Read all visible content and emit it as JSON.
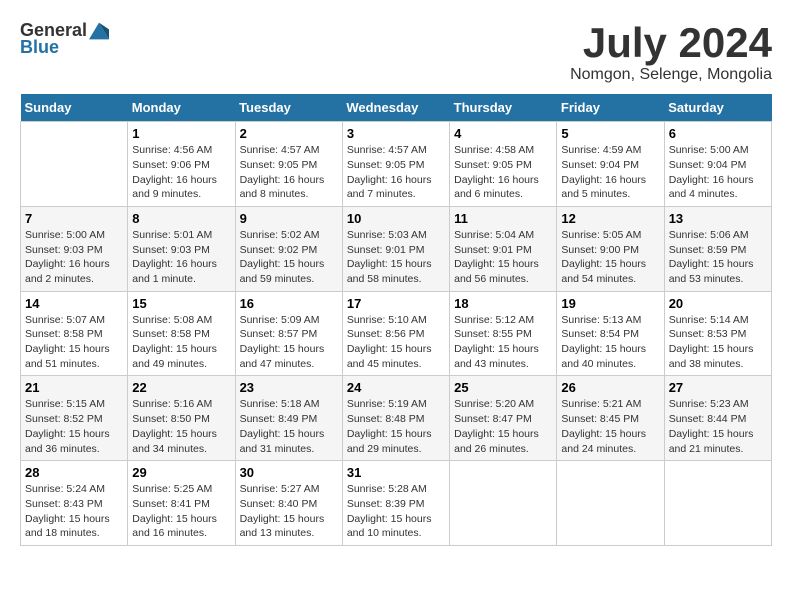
{
  "header": {
    "logo_general": "General",
    "logo_blue": "Blue",
    "title": "July 2024",
    "subtitle": "Nomgon, Selenge, Mongolia"
  },
  "days_of_week": [
    "Sunday",
    "Monday",
    "Tuesday",
    "Wednesday",
    "Thursday",
    "Friday",
    "Saturday"
  ],
  "weeks": [
    [
      {
        "day": "",
        "sunrise": "",
        "sunset": "",
        "daylight": ""
      },
      {
        "day": "1",
        "sunrise": "Sunrise: 4:56 AM",
        "sunset": "Sunset: 9:06 PM",
        "daylight": "Daylight: 16 hours and 9 minutes."
      },
      {
        "day": "2",
        "sunrise": "Sunrise: 4:57 AM",
        "sunset": "Sunset: 9:05 PM",
        "daylight": "Daylight: 16 hours and 8 minutes."
      },
      {
        "day": "3",
        "sunrise": "Sunrise: 4:57 AM",
        "sunset": "Sunset: 9:05 PM",
        "daylight": "Daylight: 16 hours and 7 minutes."
      },
      {
        "day": "4",
        "sunrise": "Sunrise: 4:58 AM",
        "sunset": "Sunset: 9:05 PM",
        "daylight": "Daylight: 16 hours and 6 minutes."
      },
      {
        "day": "5",
        "sunrise": "Sunrise: 4:59 AM",
        "sunset": "Sunset: 9:04 PM",
        "daylight": "Daylight: 16 hours and 5 minutes."
      },
      {
        "day": "6",
        "sunrise": "Sunrise: 5:00 AM",
        "sunset": "Sunset: 9:04 PM",
        "daylight": "Daylight: 16 hours and 4 minutes."
      }
    ],
    [
      {
        "day": "7",
        "sunrise": "Sunrise: 5:00 AM",
        "sunset": "Sunset: 9:03 PM",
        "daylight": "Daylight: 16 hours and 2 minutes."
      },
      {
        "day": "8",
        "sunrise": "Sunrise: 5:01 AM",
        "sunset": "Sunset: 9:03 PM",
        "daylight": "Daylight: 16 hours and 1 minute."
      },
      {
        "day": "9",
        "sunrise": "Sunrise: 5:02 AM",
        "sunset": "Sunset: 9:02 PM",
        "daylight": "Daylight: 15 hours and 59 minutes."
      },
      {
        "day": "10",
        "sunrise": "Sunrise: 5:03 AM",
        "sunset": "Sunset: 9:01 PM",
        "daylight": "Daylight: 15 hours and 58 minutes."
      },
      {
        "day": "11",
        "sunrise": "Sunrise: 5:04 AM",
        "sunset": "Sunset: 9:01 PM",
        "daylight": "Daylight: 15 hours and 56 minutes."
      },
      {
        "day": "12",
        "sunrise": "Sunrise: 5:05 AM",
        "sunset": "Sunset: 9:00 PM",
        "daylight": "Daylight: 15 hours and 54 minutes."
      },
      {
        "day": "13",
        "sunrise": "Sunrise: 5:06 AM",
        "sunset": "Sunset: 8:59 PM",
        "daylight": "Daylight: 15 hours and 53 minutes."
      }
    ],
    [
      {
        "day": "14",
        "sunrise": "Sunrise: 5:07 AM",
        "sunset": "Sunset: 8:58 PM",
        "daylight": "Daylight: 15 hours and 51 minutes."
      },
      {
        "day": "15",
        "sunrise": "Sunrise: 5:08 AM",
        "sunset": "Sunset: 8:58 PM",
        "daylight": "Daylight: 15 hours and 49 minutes."
      },
      {
        "day": "16",
        "sunrise": "Sunrise: 5:09 AM",
        "sunset": "Sunset: 8:57 PM",
        "daylight": "Daylight: 15 hours and 47 minutes."
      },
      {
        "day": "17",
        "sunrise": "Sunrise: 5:10 AM",
        "sunset": "Sunset: 8:56 PM",
        "daylight": "Daylight: 15 hours and 45 minutes."
      },
      {
        "day": "18",
        "sunrise": "Sunrise: 5:12 AM",
        "sunset": "Sunset: 8:55 PM",
        "daylight": "Daylight: 15 hours and 43 minutes."
      },
      {
        "day": "19",
        "sunrise": "Sunrise: 5:13 AM",
        "sunset": "Sunset: 8:54 PM",
        "daylight": "Daylight: 15 hours and 40 minutes."
      },
      {
        "day": "20",
        "sunrise": "Sunrise: 5:14 AM",
        "sunset": "Sunset: 8:53 PM",
        "daylight": "Daylight: 15 hours and 38 minutes."
      }
    ],
    [
      {
        "day": "21",
        "sunrise": "Sunrise: 5:15 AM",
        "sunset": "Sunset: 8:52 PM",
        "daylight": "Daylight: 15 hours and 36 minutes."
      },
      {
        "day": "22",
        "sunrise": "Sunrise: 5:16 AM",
        "sunset": "Sunset: 8:50 PM",
        "daylight": "Daylight: 15 hours and 34 minutes."
      },
      {
        "day": "23",
        "sunrise": "Sunrise: 5:18 AM",
        "sunset": "Sunset: 8:49 PM",
        "daylight": "Daylight: 15 hours and 31 minutes."
      },
      {
        "day": "24",
        "sunrise": "Sunrise: 5:19 AM",
        "sunset": "Sunset: 8:48 PM",
        "daylight": "Daylight: 15 hours and 29 minutes."
      },
      {
        "day": "25",
        "sunrise": "Sunrise: 5:20 AM",
        "sunset": "Sunset: 8:47 PM",
        "daylight": "Daylight: 15 hours and 26 minutes."
      },
      {
        "day": "26",
        "sunrise": "Sunrise: 5:21 AM",
        "sunset": "Sunset: 8:45 PM",
        "daylight": "Daylight: 15 hours and 24 minutes."
      },
      {
        "day": "27",
        "sunrise": "Sunrise: 5:23 AM",
        "sunset": "Sunset: 8:44 PM",
        "daylight": "Daylight: 15 hours and 21 minutes."
      }
    ],
    [
      {
        "day": "28",
        "sunrise": "Sunrise: 5:24 AM",
        "sunset": "Sunset: 8:43 PM",
        "daylight": "Daylight: 15 hours and 18 minutes."
      },
      {
        "day": "29",
        "sunrise": "Sunrise: 5:25 AM",
        "sunset": "Sunset: 8:41 PM",
        "daylight": "Daylight: 15 hours and 16 minutes."
      },
      {
        "day": "30",
        "sunrise": "Sunrise: 5:27 AM",
        "sunset": "Sunset: 8:40 PM",
        "daylight": "Daylight: 15 hours and 13 minutes."
      },
      {
        "day": "31",
        "sunrise": "Sunrise: 5:28 AM",
        "sunset": "Sunset: 8:39 PM",
        "daylight": "Daylight: 15 hours and 10 minutes."
      },
      {
        "day": "",
        "sunrise": "",
        "sunset": "",
        "daylight": ""
      },
      {
        "day": "",
        "sunrise": "",
        "sunset": "",
        "daylight": ""
      },
      {
        "day": "",
        "sunrise": "",
        "sunset": "",
        "daylight": ""
      }
    ]
  ]
}
